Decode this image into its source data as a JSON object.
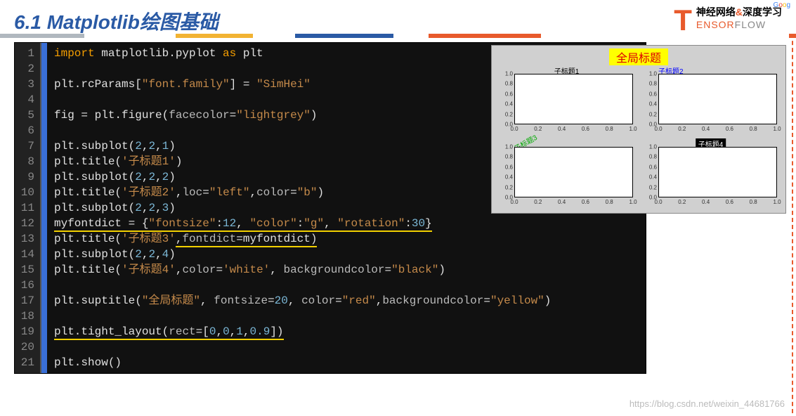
{
  "header": {
    "title": "6.1 Matplotlib绘图基础",
    "logo": {
      "t": "T",
      "line1_a": "神经网络",
      "line1_amp": "&",
      "line1_b": "深度学习",
      "line2_e": "ENSOR",
      "line2_rest": "FLOW",
      "corner": [
        "G",
        "o",
        "o",
        "g"
      ]
    }
  },
  "code": {
    "lines": [
      {
        "n": 1,
        "tokens": [
          {
            "c": "kw",
            "t": "import"
          },
          {
            "c": "",
            "t": " matplotlib.pyplot "
          },
          {
            "c": "kw",
            "t": "as"
          },
          {
            "c": "",
            "t": " plt"
          }
        ]
      },
      {
        "n": 2,
        "tokens": []
      },
      {
        "n": 3,
        "tokens": [
          {
            "c": "",
            "t": "plt.rcParams["
          },
          {
            "c": "str",
            "t": "\"font.family\""
          },
          {
            "c": "",
            "t": "] = "
          },
          {
            "c": "str",
            "t": "\"SimHei\""
          }
        ]
      },
      {
        "n": 4,
        "tokens": []
      },
      {
        "n": 5,
        "tokens": [
          {
            "c": "",
            "t": "fig = plt.figure("
          },
          {
            "c": "arg",
            "t": "facecolor"
          },
          {
            "c": "",
            "t": "="
          },
          {
            "c": "str",
            "t": "\"lightgrey\""
          },
          {
            "c": "",
            "t": ")"
          }
        ]
      },
      {
        "n": 6,
        "tokens": []
      },
      {
        "n": 7,
        "tokens": [
          {
            "c": "",
            "t": "plt.subplot("
          },
          {
            "c": "num",
            "t": "2"
          },
          {
            "c": "",
            "t": ","
          },
          {
            "c": "num",
            "t": "2"
          },
          {
            "c": "",
            "t": ","
          },
          {
            "c": "num",
            "t": "1"
          },
          {
            "c": "",
            "t": ")"
          }
        ]
      },
      {
        "n": 8,
        "tokens": [
          {
            "c": "",
            "t": "plt.title("
          },
          {
            "c": "str",
            "t": "'子标题1'"
          },
          {
            "c": "",
            "t": ")"
          }
        ]
      },
      {
        "n": 9,
        "tokens": [
          {
            "c": "",
            "t": "plt.subplot("
          },
          {
            "c": "num",
            "t": "2"
          },
          {
            "c": "",
            "t": ","
          },
          {
            "c": "num",
            "t": "2"
          },
          {
            "c": "",
            "t": ","
          },
          {
            "c": "num",
            "t": "2"
          },
          {
            "c": "",
            "t": ")"
          }
        ]
      },
      {
        "n": 10,
        "tokens": [
          {
            "c": "",
            "t": "plt.title("
          },
          {
            "c": "str",
            "t": "'子标题2'"
          },
          {
            "c": "",
            "t": ","
          },
          {
            "c": "arg",
            "t": "loc"
          },
          {
            "c": "",
            "t": "="
          },
          {
            "c": "str",
            "t": "\"left\""
          },
          {
            "c": "",
            "t": ","
          },
          {
            "c": "arg",
            "t": "color"
          },
          {
            "c": "",
            "t": "="
          },
          {
            "c": "str",
            "t": "\"b\""
          },
          {
            "c": "",
            "t": ")"
          }
        ]
      },
      {
        "n": 11,
        "tokens": [
          {
            "c": "",
            "t": "plt.subplot("
          },
          {
            "c": "num",
            "t": "2"
          },
          {
            "c": "",
            "t": ","
          },
          {
            "c": "num",
            "t": "2"
          },
          {
            "c": "",
            "t": ","
          },
          {
            "c": "num",
            "t": "3"
          },
          {
            "c": "",
            "t": ")"
          }
        ]
      },
      {
        "n": 12,
        "ul": true,
        "tokens": [
          {
            "c": "",
            "t": "myfontdict = {"
          },
          {
            "c": "str",
            "t": "\"fontsize\""
          },
          {
            "c": "",
            "t": ":"
          },
          {
            "c": "num",
            "t": "12"
          },
          {
            "c": "",
            "t": ", "
          },
          {
            "c": "str",
            "t": "\"color\""
          },
          {
            "c": "",
            "t": ":"
          },
          {
            "c": "str",
            "t": "\"g\""
          },
          {
            "c": "",
            "t": ", "
          },
          {
            "c": "str",
            "t": "\"rotation\""
          },
          {
            "c": "",
            "t": ":"
          },
          {
            "c": "num",
            "t": "30"
          },
          {
            "c": "",
            "t": "}"
          }
        ]
      },
      {
        "n": 13,
        "tokens": [
          {
            "c": "",
            "t": "plt.title("
          },
          {
            "c": "str",
            "t": "'子标题3'"
          },
          {
            "c": "ul",
            "t": ""
          },
          {
            "c": "",
            "t": ","
          },
          {
            "c": "arg ul2",
            "t": "fontdict"
          },
          {
            "c": "",
            "t": "="
          },
          {
            "c": "ident",
            "t": "myfontdict"
          },
          {
            "c": "",
            "t": ")"
          }
        ],
        "ul_partial": true
      },
      {
        "n": 14,
        "tokens": [
          {
            "c": "",
            "t": "plt.subplot("
          },
          {
            "c": "num",
            "t": "2"
          },
          {
            "c": "",
            "t": ","
          },
          {
            "c": "num",
            "t": "2"
          },
          {
            "c": "",
            "t": ","
          },
          {
            "c": "num",
            "t": "4"
          },
          {
            "c": "",
            "t": ")"
          }
        ]
      },
      {
        "n": 15,
        "tokens": [
          {
            "c": "",
            "t": "plt.title("
          },
          {
            "c": "str",
            "t": "'子标题4'"
          },
          {
            "c": "",
            "t": ","
          },
          {
            "c": "arg",
            "t": "color"
          },
          {
            "c": "",
            "t": "="
          },
          {
            "c": "str",
            "t": "'white'"
          },
          {
            "c": "",
            "t": ", "
          },
          {
            "c": "arg",
            "t": "backgroundcolor"
          },
          {
            "c": "",
            "t": "="
          },
          {
            "c": "str",
            "t": "\"black\""
          },
          {
            "c": "",
            "t": ")"
          }
        ]
      },
      {
        "n": 16,
        "tokens": []
      },
      {
        "n": 17,
        "tokens": [
          {
            "c": "",
            "t": "plt.suptitle("
          },
          {
            "c": "str",
            "t": "\"全局标题\""
          },
          {
            "c": "",
            "t": ", "
          },
          {
            "c": "arg",
            "t": "fontsize"
          },
          {
            "c": "",
            "t": "="
          },
          {
            "c": "num",
            "t": "20"
          },
          {
            "c": "",
            "t": ", "
          },
          {
            "c": "arg",
            "t": "color"
          },
          {
            "c": "",
            "t": "="
          },
          {
            "c": "str",
            "t": "\"red\""
          },
          {
            "c": "",
            "t": ","
          },
          {
            "c": "arg",
            "t": "backgroundcolor"
          },
          {
            "c": "",
            "t": "="
          },
          {
            "c": "str",
            "t": "\"yellow\""
          },
          {
            "c": "",
            "t": ")"
          }
        ]
      },
      {
        "n": 18,
        "tokens": []
      },
      {
        "n": 19,
        "ul": true,
        "tokens": [
          {
            "c": "",
            "t": "plt.tight_layout("
          },
          {
            "c": "arg",
            "t": "rect"
          },
          {
            "c": "",
            "t": "=["
          },
          {
            "c": "num",
            "t": "0"
          },
          {
            "c": "",
            "t": ","
          },
          {
            "c": "num",
            "t": "0"
          },
          {
            "c": "",
            "t": ","
          },
          {
            "c": "num",
            "t": "1"
          },
          {
            "c": "",
            "t": ","
          },
          {
            "c": "num",
            "t": "0.9"
          },
          {
            "c": "",
            "t": "])"
          }
        ]
      },
      {
        "n": 20,
        "tokens": []
      },
      {
        "n": 21,
        "tokens": [
          {
            "c": "",
            "t": "plt.show()"
          }
        ]
      }
    ]
  },
  "chart": {
    "suptitle": "全局标题",
    "yticks": [
      "1.0",
      "0.8",
      "0.6",
      "0.4",
      "0.2",
      "0.0"
    ],
    "xticks": [
      "0.0",
      "0.2",
      "0.4",
      "0.6",
      "0.8",
      "1.0"
    ],
    "subs": [
      {
        "title": "子标题1",
        "style": "top-center"
      },
      {
        "title": "子标题2",
        "style": "top-left"
      },
      {
        "title": "子标题3",
        "style": "rot"
      },
      {
        "title": "子标题4",
        "style": "black"
      }
    ]
  },
  "chart_data": {
    "type": "area",
    "suptitle": "全局标题",
    "facecolor": "lightgrey",
    "layout": {
      "rows": 2,
      "cols": 2
    },
    "series": [
      {
        "name": "子标题1",
        "title": {
          "text": "子标题1",
          "loc": "center",
          "color": "black"
        },
        "xlim": [
          0,
          1
        ],
        "ylim": [
          0,
          1
        ],
        "values": []
      },
      {
        "name": "子标题2",
        "title": {
          "text": "子标题2",
          "loc": "left",
          "color": "b"
        },
        "xlim": [
          0,
          1
        ],
        "ylim": [
          0,
          1
        ],
        "values": []
      },
      {
        "name": "子标题3",
        "title": {
          "text": "子标题3",
          "fontdict": {
            "fontsize": 12,
            "color": "g",
            "rotation": 30
          }
        },
        "xlim": [
          0,
          1
        ],
        "ylim": [
          0,
          1
        ],
        "values": []
      },
      {
        "name": "子标题4",
        "title": {
          "text": "子标题4",
          "color": "white",
          "backgroundcolor": "black"
        },
        "xlim": [
          0,
          1
        ],
        "ylim": [
          0,
          1
        ],
        "values": []
      }
    ],
    "xticks": [
      0.0,
      0.2,
      0.4,
      0.6,
      0.8,
      1.0
    ],
    "yticks": [
      0.0,
      0.2,
      0.4,
      0.6,
      0.8,
      1.0
    ],
    "tight_layout_rect": [
      0,
      0,
      1,
      0.9
    ]
  },
  "watermark": "https://blog.csdn.net/weixin_44681766"
}
